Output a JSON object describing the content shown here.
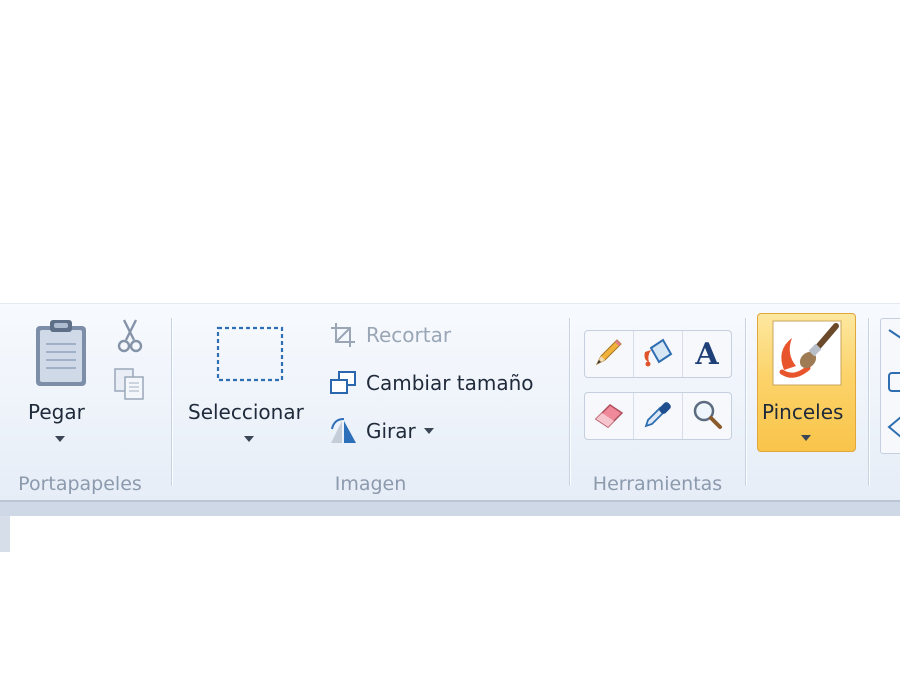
{
  "ribbon": {
    "groups": {
      "clipboard": {
        "label": "Portapapeles",
        "paste_label": "Pegar"
      },
      "image": {
        "label": "Imagen",
        "select_label": "Seleccionar",
        "crop_label": "Recortar",
        "resize_label": "Cambiar tamaño",
        "rotate_label": "Girar"
      },
      "tools": {
        "label": "Herramientas",
        "items": [
          "pencil",
          "fill",
          "text",
          "eraser",
          "color-picker",
          "magnifier"
        ]
      },
      "brushes": {
        "label": "Pinceles"
      }
    }
  },
  "colors": {
    "ribbon_bg": "#eef3fa",
    "brush_active": "#fcd36a",
    "group_label": "#8c9aad"
  }
}
